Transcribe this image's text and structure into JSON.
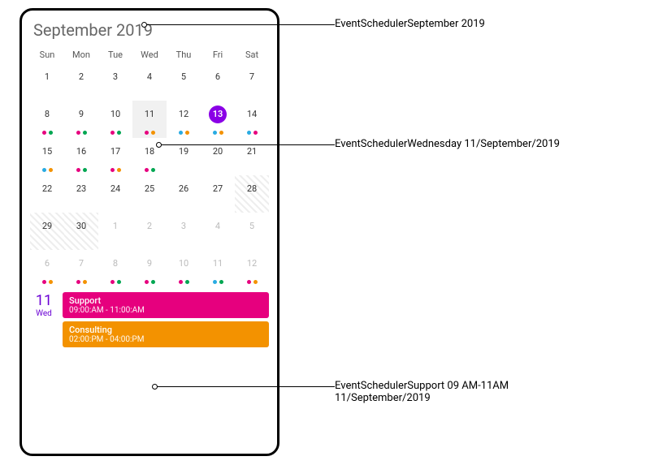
{
  "title": "September 2019",
  "dow": [
    "Sun",
    "Mon",
    "Tue",
    "Wed",
    "Thu",
    "Fri",
    "Sat"
  ],
  "colors": {
    "pink": "#e6007e",
    "orange": "#f39200",
    "green": "#00a651",
    "blue": "#29abe2",
    "purple": "#8a00e6"
  },
  "weeks": [
    [
      {
        "num": "1"
      },
      {
        "num": "2"
      },
      {
        "num": "3"
      },
      {
        "num": "4"
      },
      {
        "num": "5"
      },
      {
        "num": "6"
      },
      {
        "num": "7"
      }
    ],
    [
      {
        "num": "8",
        "dots": [
          "pink",
          "green"
        ]
      },
      {
        "num": "9",
        "dots": [
          "pink",
          "green"
        ]
      },
      {
        "num": "10",
        "dots": [
          "pink",
          "green"
        ]
      },
      {
        "num": "11",
        "dots": [
          "pink",
          "orange"
        ],
        "selected": true
      },
      {
        "num": "12",
        "dots": [
          "blue",
          "orange"
        ]
      },
      {
        "num": "13",
        "dots": [
          "blue",
          "orange"
        ],
        "highlight": true
      },
      {
        "num": "14",
        "dots": [
          "blue",
          "pink"
        ]
      }
    ],
    [
      {
        "num": "15",
        "dots": [
          "blue",
          "orange"
        ]
      },
      {
        "num": "16",
        "dots": [
          "pink",
          "green"
        ]
      },
      {
        "num": "17",
        "dots": [
          "pink",
          "orange"
        ]
      },
      {
        "num": "18",
        "dots": [
          "pink",
          "green"
        ]
      },
      {
        "num": "19"
      },
      {
        "num": "20"
      },
      {
        "num": "21"
      }
    ],
    [
      {
        "num": "22"
      },
      {
        "num": "23"
      },
      {
        "num": "24"
      },
      {
        "num": "25"
      },
      {
        "num": "26"
      },
      {
        "num": "27"
      },
      {
        "num": "28",
        "hatched": true
      }
    ],
    [
      {
        "num": "29",
        "hatched": true
      },
      {
        "num": "30",
        "hatched": true
      },
      {
        "num": "1",
        "other": true
      },
      {
        "num": "2",
        "other": true
      },
      {
        "num": "3",
        "other": true
      },
      {
        "num": "4",
        "other": true
      },
      {
        "num": "5",
        "other": true
      }
    ],
    [
      {
        "num": "6",
        "other": true,
        "dots": [
          "pink",
          "orange"
        ]
      },
      {
        "num": "7",
        "other": true,
        "dots": [
          "pink",
          "orange"
        ]
      },
      {
        "num": "8",
        "other": true,
        "dots": [
          "pink",
          "green"
        ]
      },
      {
        "num": "9",
        "other": true,
        "dots": [
          "pink",
          "green"
        ]
      },
      {
        "num": "10",
        "other": true,
        "dots": [
          "pink",
          "green"
        ]
      },
      {
        "num": "11",
        "other": true,
        "dots": [
          "blue",
          "green"
        ]
      },
      {
        "num": "12",
        "other": true,
        "dots": [
          "pink",
          "orange"
        ]
      }
    ]
  ],
  "selected": {
    "num": "11",
    "wd": "Wed"
  },
  "events": [
    {
      "title": "Support",
      "time": "09:00:AM - 11:00:AM",
      "color": "#e6007e"
    },
    {
      "title": "Consulting",
      "time": "02:00:PM - 04:00:PM",
      "color": "#f39200"
    }
  ],
  "annotations": {
    "a1": "EventSchedulerSeptember 2019",
    "a2": "EventSchedulerWednesday 11/September/2019",
    "a3a": "EventSchedulerSupport 09 AM-11AM",
    "a3b": "11/September/2019"
  }
}
